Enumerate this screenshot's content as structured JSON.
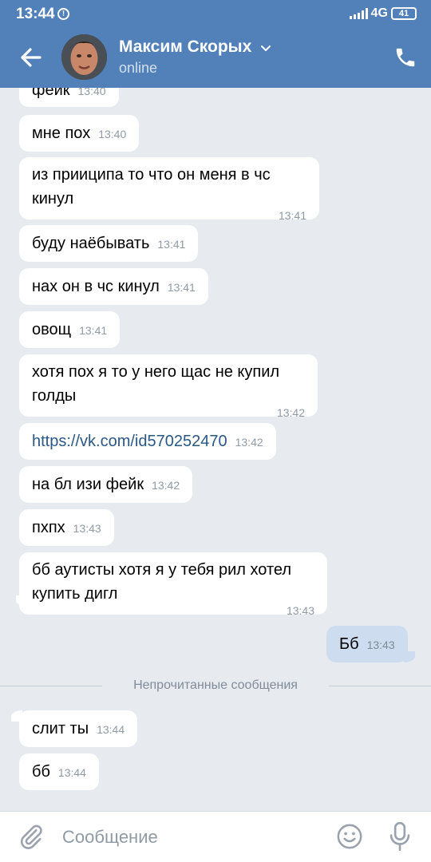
{
  "status_bar": {
    "time": "13:44",
    "network": "4G",
    "battery": "41"
  },
  "header": {
    "contact_name": "Максим Скорых",
    "contact_status": "online",
    "accent_color": "#5181b8"
  },
  "messages": [
    {
      "text": "фейк",
      "time": "13:40"
    },
    {
      "text": "мне пох",
      "time": "13:40"
    },
    {
      "text": "из прииципа то что он меня в чс кинул",
      "time": "13:41"
    },
    {
      "text": "буду наёбывать",
      "time": "13:41"
    },
    {
      "text": "нах он в чс кинул",
      "time": "13:41"
    },
    {
      "text": "овощ",
      "time": "13:41"
    },
    {
      "text": "хотя пох я то у него щас не купил голды",
      "time": "13:42"
    },
    {
      "text": "https://vk.com/id570252470",
      "time": "13:42"
    },
    {
      "text": "на бл изи фейк",
      "time": "13:42"
    },
    {
      "text": "пхпх",
      "time": "13:43"
    },
    {
      "text": "бб аутисты хотя я у тебя рил хотел купить дигл",
      "time": "13:43"
    },
    {
      "text": "Бб",
      "time": "13:43"
    },
    {
      "text": "слит ты",
      "time": "13:44"
    },
    {
      "text": "бб",
      "time": "13:44"
    }
  ],
  "unread_divider": "Непрочитанные сообщения",
  "composer": {
    "placeholder": "Сообщение"
  }
}
